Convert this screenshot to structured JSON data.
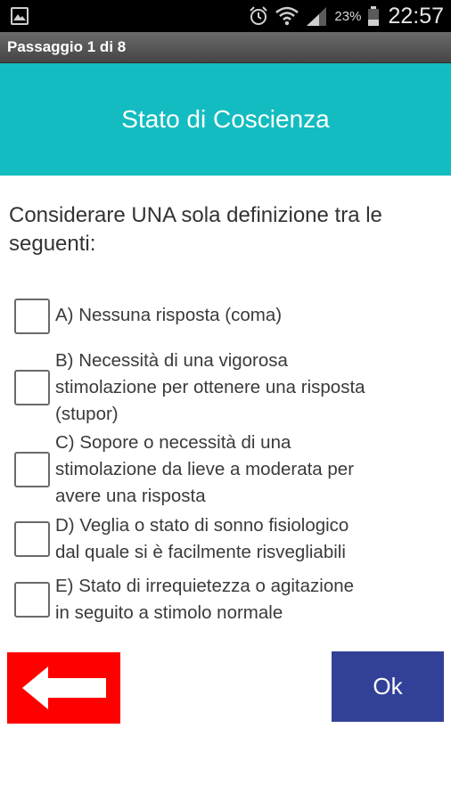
{
  "status_bar": {
    "battery_percent": "23%",
    "time": "22:57",
    "icons": [
      "gallery-icon",
      "alarm-icon",
      "wifi-icon",
      "signal-icon",
      "battery-icon"
    ]
  },
  "titlebar": {
    "step": "Passaggio 1 di 8"
  },
  "header": {
    "title": "Stato di Coscienza",
    "color": "#13bcc0"
  },
  "instruction": "Considerare UNA sola definizione tra le seguenti:",
  "options": [
    {
      "lines": [
        "A) Nessuna risposta (coma)"
      ],
      "checked": false
    },
    {
      "lines": [
        "B) Necessità di una vigorosa",
        "stimolazione per ottenere una risposta",
        "(stupor)"
      ],
      "checked": false
    },
    {
      "lines": [
        "C) Sopore o necessità di una",
        "stimolazione da lieve a moderata per",
        "avere una risposta"
      ],
      "checked": false
    },
    {
      "lines": [
        "D) Veglia o stato di sonno fisiologico",
        "dal quale si è facilmente risvegliabili"
      ],
      "checked": false
    },
    {
      "lines": [
        "E) Stato di irrequietezza o agitazione",
        "in seguito a stimolo normale"
      ],
      "checked": false
    }
  ],
  "buttons": {
    "back": {
      "icon": "arrow-left-icon",
      "color": "#ff0000"
    },
    "ok": {
      "label": "Ok",
      "color": "#324197"
    }
  }
}
